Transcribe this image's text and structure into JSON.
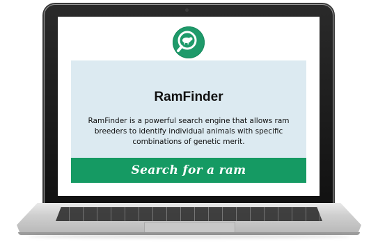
{
  "app": {
    "title": "RamFinder",
    "description": "RamFinder is a powerful search engine that allows ram breeders to identify individual animals with specific combinations of genetic merit.",
    "cta_label": "Search for a ram"
  },
  "logo": {
    "icon": "sheep-magnifier-icon"
  },
  "colors": {
    "accent": "#1e9a6a",
    "button": "#159a63",
    "card_background": "#dceaf1",
    "text": "#111111"
  }
}
